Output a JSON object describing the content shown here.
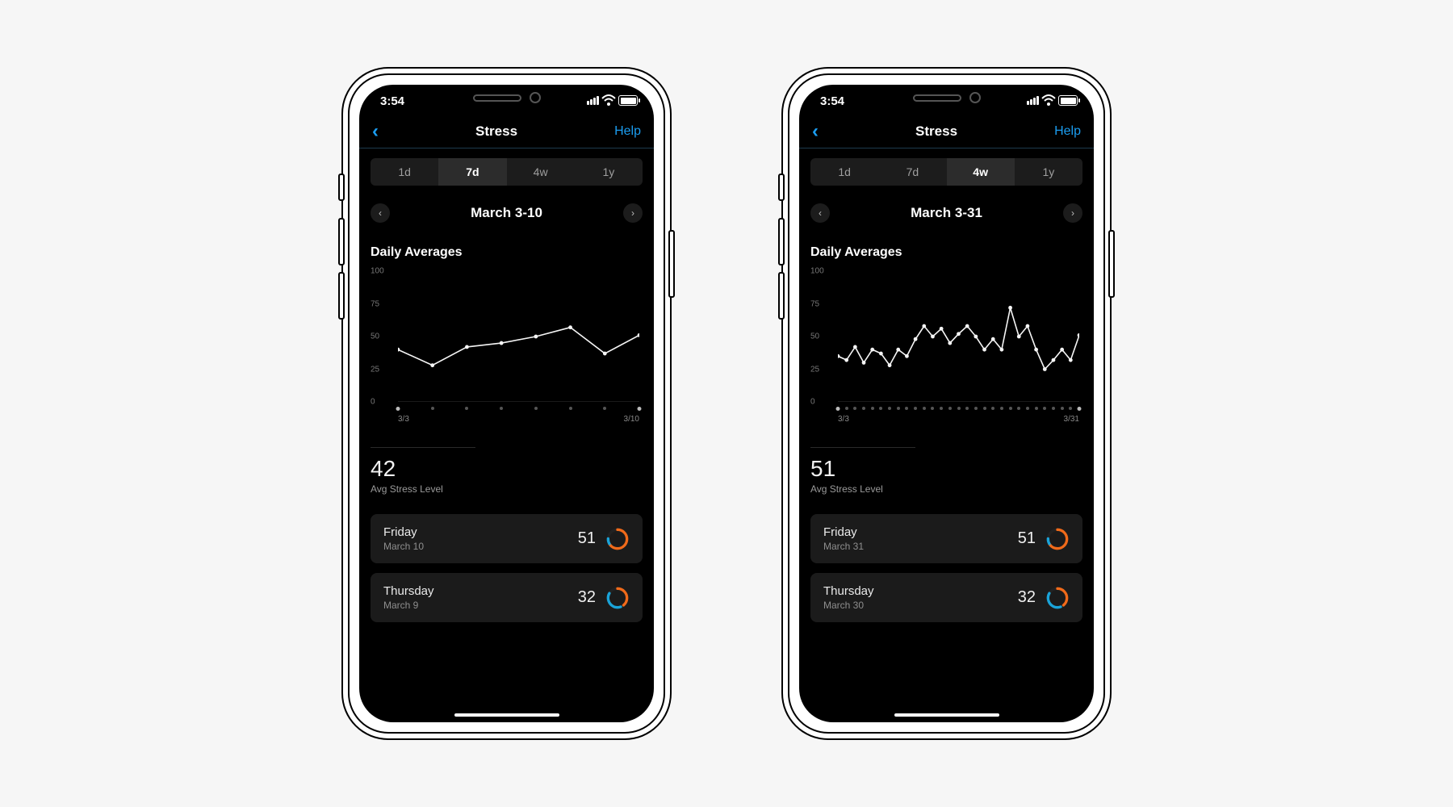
{
  "status": {
    "time": "3:54"
  },
  "nav": {
    "title": "Stress",
    "help": "Help"
  },
  "time_segments": [
    "1d",
    "7d",
    "4w",
    "1y"
  ],
  "section_title": "Daily Averages",
  "yticks": [
    100,
    75,
    50,
    25,
    0
  ],
  "left": {
    "active_segment": "7d",
    "range": "March 3-10",
    "x_start": "3/3",
    "x_end": "3/10",
    "avg_value": "42",
    "avg_label": "Avg Stress Level",
    "cards": [
      {
        "day": "Friday",
        "date": "March 10",
        "value": "51"
      },
      {
        "day": "Thursday",
        "date": "March 9",
        "value": "32"
      }
    ]
  },
  "right": {
    "active_segment": "4w",
    "range": "March 3-31",
    "x_start": "3/3",
    "x_end": "3/31",
    "avg_value": "51",
    "avg_label": "Avg Stress Level",
    "cards": [
      {
        "day": "Friday",
        "date": "March 31",
        "value": "51"
      },
      {
        "day": "Thursday",
        "date": "March 30",
        "value": "32"
      }
    ]
  },
  "chart_data": [
    {
      "type": "line",
      "title": "Daily Averages",
      "ylabel": "Stress",
      "ylim": [
        0,
        100
      ],
      "x": [
        "3/3",
        "3/4",
        "3/5",
        "3/6",
        "3/7",
        "3/8",
        "3/9",
        "3/10"
      ],
      "values": [
        40,
        28,
        42,
        45,
        50,
        57,
        37,
        51
      ]
    },
    {
      "type": "line",
      "title": "Daily Averages",
      "ylabel": "Stress",
      "ylim": [
        0,
        100
      ],
      "x": [
        "3/3",
        "3/4",
        "3/5",
        "3/6",
        "3/7",
        "3/8",
        "3/9",
        "3/10",
        "3/11",
        "3/12",
        "3/13",
        "3/14",
        "3/15",
        "3/16",
        "3/17",
        "3/18",
        "3/19",
        "3/20",
        "3/21",
        "3/22",
        "3/23",
        "3/24",
        "3/25",
        "3/26",
        "3/27",
        "3/28",
        "3/29",
        "3/30",
        "3/31"
      ],
      "values": [
        35,
        32,
        42,
        30,
        40,
        37,
        28,
        40,
        35,
        48,
        58,
        50,
        56,
        45,
        52,
        58,
        50,
        40,
        48,
        40,
        72,
        50,
        58,
        40,
        25,
        32,
        40,
        32,
        51
      ]
    }
  ]
}
